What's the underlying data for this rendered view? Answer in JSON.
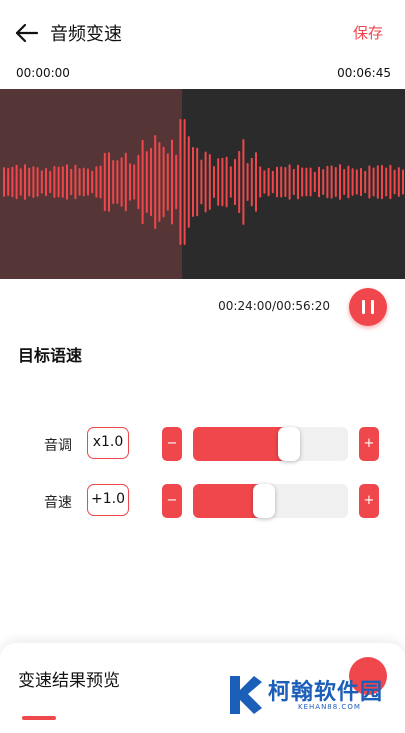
{
  "header": {
    "back_icon": "arrow-left-icon",
    "title": "音频变速",
    "save_label": "保存"
  },
  "timeline": {
    "start": "00:00:00",
    "end": "00:06:45"
  },
  "waveform": {
    "played_fraction": 0.45,
    "colors": {
      "background": "#2b2b2b",
      "played_background": "#563536",
      "wave": "#F0474C"
    }
  },
  "player": {
    "time_display": "00:24:00/00:56:20",
    "pause_icon": "pause-icon"
  },
  "section": {
    "title": "目标语速"
  },
  "controls": [
    {
      "label": "音调",
      "value": "x1.0",
      "minus": "−",
      "plus": "+",
      "level": 0.62
    },
    {
      "label": "音速",
      "value": "+1.0",
      "minus": "−",
      "plus": "+",
      "level": 0.46
    }
  ],
  "preview": {
    "title": "变速结果预览"
  },
  "watermark": {
    "brand": "柯翰软件园",
    "domain": "KEHAN88.COM"
  },
  "colors": {
    "accent": "#F0474C"
  }
}
